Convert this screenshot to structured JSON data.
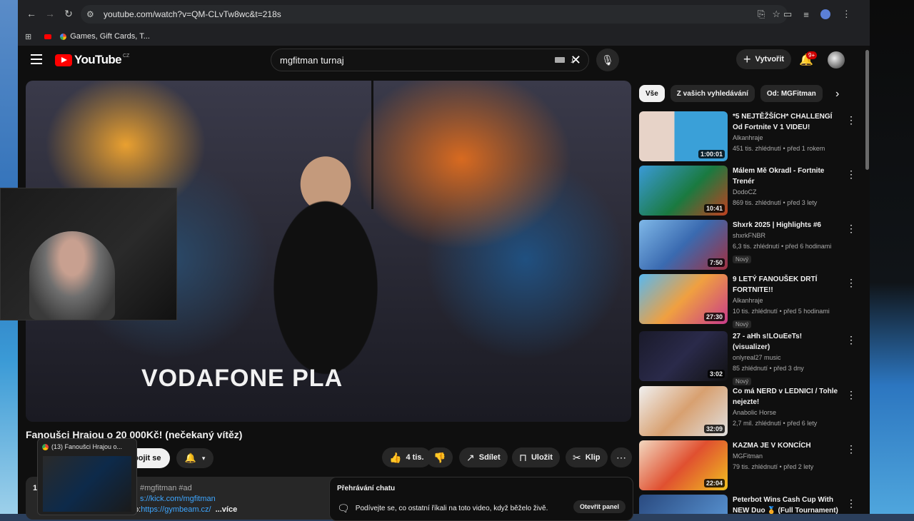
{
  "browser": {
    "url": "youtube.com/watch?v=QM-CLvTw8wc&t=218s",
    "bookmarks": [
      {
        "label": "Games, Gift Cards, T..."
      }
    ]
  },
  "youtube": {
    "logo_text": "YouTube",
    "logo_region": "CZ",
    "search_query": "mgfitman turnaj",
    "create_label": "Vytvořit",
    "notif_count": "9+"
  },
  "video": {
    "title": "Fanoušci Hrajou o 20 000Kč! (nečekaný vítěz)",
    "stage_text": "VODAFONE PLA",
    "subscribe_label": "pojit se",
    "like_count": "4 tis.",
    "share_label": "Sdílet",
    "save_label": "Uložit",
    "clip_label": "Klip",
    "description": {
      "line1_prefix": "1",
      "hashtags": "#mgfitman #ad",
      "link1": "s://kick.com/mgfitman",
      "link2_prefix": "p: ",
      "link2": "https://gymbeam.cz/",
      "more": "...více"
    },
    "chat": {
      "title": "Přehrávání chatu",
      "message": "Podívejte se, co ostatní říkali na toto video, když běželo živě.",
      "open_label": "Otevřít panel"
    }
  },
  "popup": {
    "title": "(13) Fanoušci Hrajou o..."
  },
  "chips": [
    {
      "label": "Vše"
    },
    {
      "label": "Z vašich vyhledávání"
    },
    {
      "label": "Od: MGFitman"
    }
  ],
  "recommendations": [
    {
      "title": "*5 NEJTĚŽŠÍCH* CHALLENGÍ Od Fortnite V 1 VIDEU!",
      "channel": "Alkanhraje",
      "views": "451 tis. zhlédnutí • před 1 rokem",
      "duration": "1:00:01",
      "new": ""
    },
    {
      "title": "Málem Mě Okradl - Fortnite Trenér",
      "channel": "DodoCZ",
      "views": "869 tis. zhlédnutí • před 3 lety",
      "duration": "10:41",
      "new": ""
    },
    {
      "title": "Shxrk 2025 | Highlights #6",
      "channel": "shxrkFNBR",
      "views": "6,3 tis. zhlédnutí • před 6 hodinami",
      "duration": "7:50",
      "new": "Nový"
    },
    {
      "title": "9 LETÝ FANOUŠEK DRTÍ FORTNITE!!",
      "channel": "Alkanhraje",
      "views": "10 tis. zhlédnutí • před 5 hodinami",
      "duration": "27:30",
      "new": "Nový"
    },
    {
      "title": "27 - aHh s!LOuEeTs! (visualizer)",
      "channel": "onlyreal27 music",
      "views": "85 zhlédnutí • před 3 dny",
      "duration": "3:02",
      "new": "Nový"
    },
    {
      "title": "Co má NERD v LEDNICI / Tohle nejezte!",
      "channel": "Anabolic Horse",
      "views": "2,7 mil. zhlédnutí • před 6 lety",
      "duration": "32:09",
      "new": ""
    },
    {
      "title": "KAZMA JE V KONCÍCH",
      "channel": "MGFitman",
      "views": "79 tis. zhlédnutí • před 2 lety",
      "duration": "22:04",
      "new": ""
    },
    {
      "title": "Peterbot Wins Cash Cup With NEW Duo 🏅 (Full Tournament)",
      "channel": "",
      "views": "",
      "duration": "",
      "new": ""
    }
  ],
  "colors": {
    "accent": "#ff0000",
    "background": "#0f0f0f",
    "chip_active": "#f1f1f1"
  }
}
